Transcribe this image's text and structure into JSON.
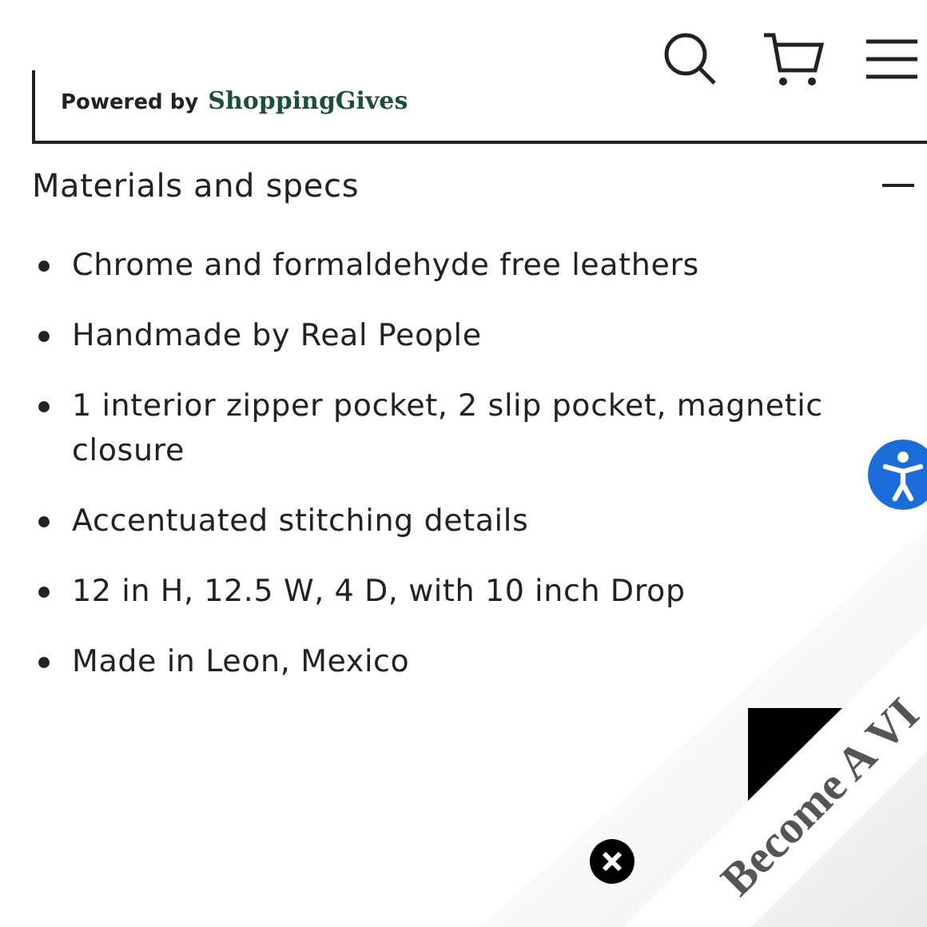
{
  "donation_box": {
    "powered_by": "Powered by",
    "brand": "ShoppingGives"
  },
  "section": {
    "title": "Materials and specs",
    "expanded": true,
    "items": [
      "Chrome and formaldehyde free leathers",
      "Handmade by Real People",
      "1 interior zipper pocket, 2 slip pocket, magnetic closure",
      "Accentuated stitching details",
      "12 in H, 12.5 W, 4 D, with 10 inch Drop",
      "Made in Leon, Mexico"
    ]
  },
  "vip_banner": {
    "text": "Become A VI"
  }
}
